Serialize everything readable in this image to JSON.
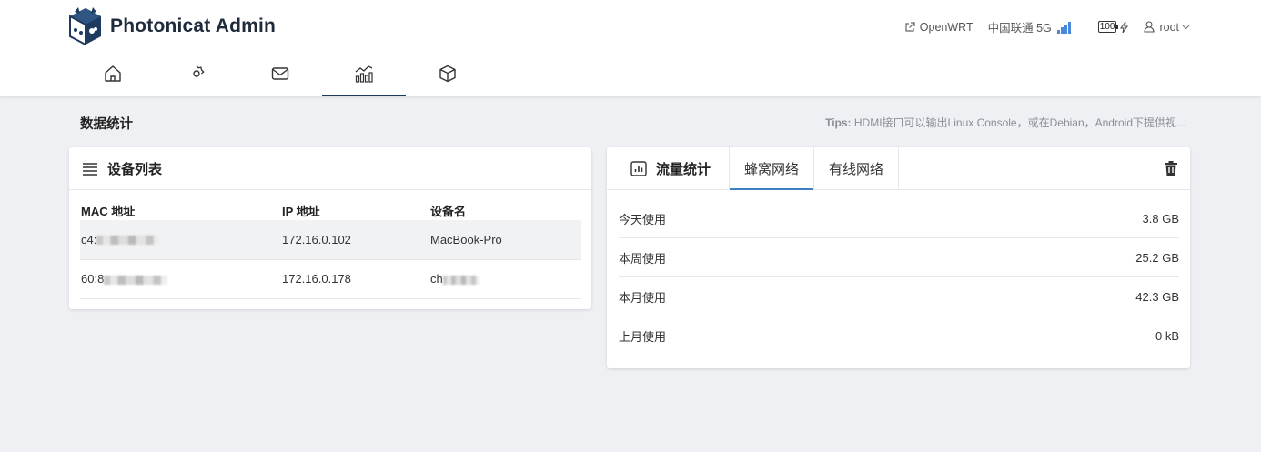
{
  "app": {
    "title": "Photonicat Admin"
  },
  "status": {
    "openwrt_label": "OpenWRT",
    "carrier": "中国联通 5G",
    "battery": "100",
    "user": "root"
  },
  "nav": [
    {
      "icon": "home-icon"
    },
    {
      "icon": "gear-icon"
    },
    {
      "icon": "mail-icon"
    },
    {
      "icon": "stats-chart-icon",
      "active": true
    },
    {
      "icon": "package-box-icon"
    }
  ],
  "page": {
    "title": "数据统计",
    "tips_label": "Tips:",
    "tips_text": "HDMI接口可以输出Linux Console，或在Debian，Android下提供视..."
  },
  "devices": {
    "title": "设备列表",
    "headers": {
      "mac": "MAC 地址",
      "ip": "IP 地址",
      "name": "设备名"
    },
    "rows": [
      {
        "mac": "c4:",
        "ip": "172.16.0.102",
        "name": "MacBook-Pro"
      },
      {
        "mac": "60:8",
        "ip": "172.16.0.178",
        "name": "ch"
      }
    ]
  },
  "traffic": {
    "title": "流量统计",
    "tabs": [
      "蜂窝网络",
      "有线网络"
    ],
    "active_tab": "蜂窝网络",
    "rows": [
      {
        "label": "今天使用",
        "value": "3.8 GB"
      },
      {
        "label": "本周使用",
        "value": "25.2 GB"
      },
      {
        "label": "本月使用",
        "value": "42.3 GB"
      },
      {
        "label": "上月使用",
        "value": "0 kB"
      }
    ]
  },
  "colors": {
    "accent": "#3e7ec4",
    "nav_active": "#1f3a5f",
    "signal": "#4a88d9"
  }
}
